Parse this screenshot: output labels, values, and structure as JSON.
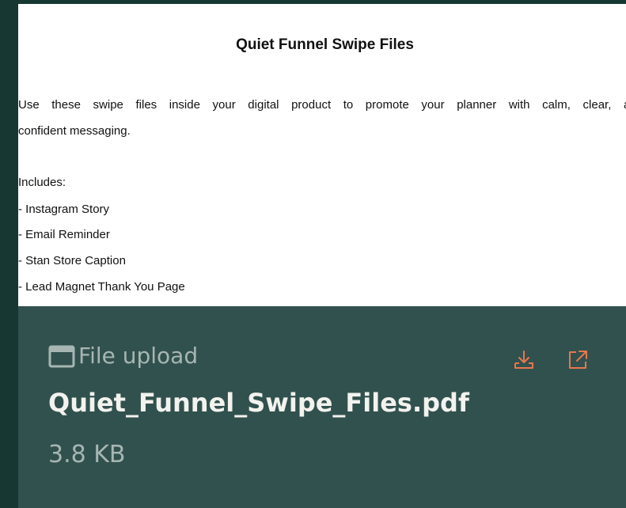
{
  "preview": {
    "title": "Quiet Funnel Swipe Files",
    "intro_line_1": "Use these swipe files inside your digital product to promote your planner with calm, clear, and",
    "intro_line_2": "confident messaging.",
    "includes_label": "Includes:",
    "includes": [
      "- Instagram Story",
      "- Email Reminder",
      "- Stan Store Caption",
      "- Lead Magnet Thank You Page"
    ]
  },
  "attachment": {
    "type_label": "File upload",
    "type_icon": "window-icon",
    "file_name": "Quiet_Funnel_Swipe_Files.pdf",
    "file_size": "3.8 KB",
    "actions": {
      "download_icon": "download-icon",
      "open_icon": "external-link-icon"
    }
  },
  "colors": {
    "background": "#173832",
    "footer": "#31514e",
    "accent": "#e8774e",
    "file_name": "#f2f2ee",
    "muted": "#a7b6b3"
  }
}
